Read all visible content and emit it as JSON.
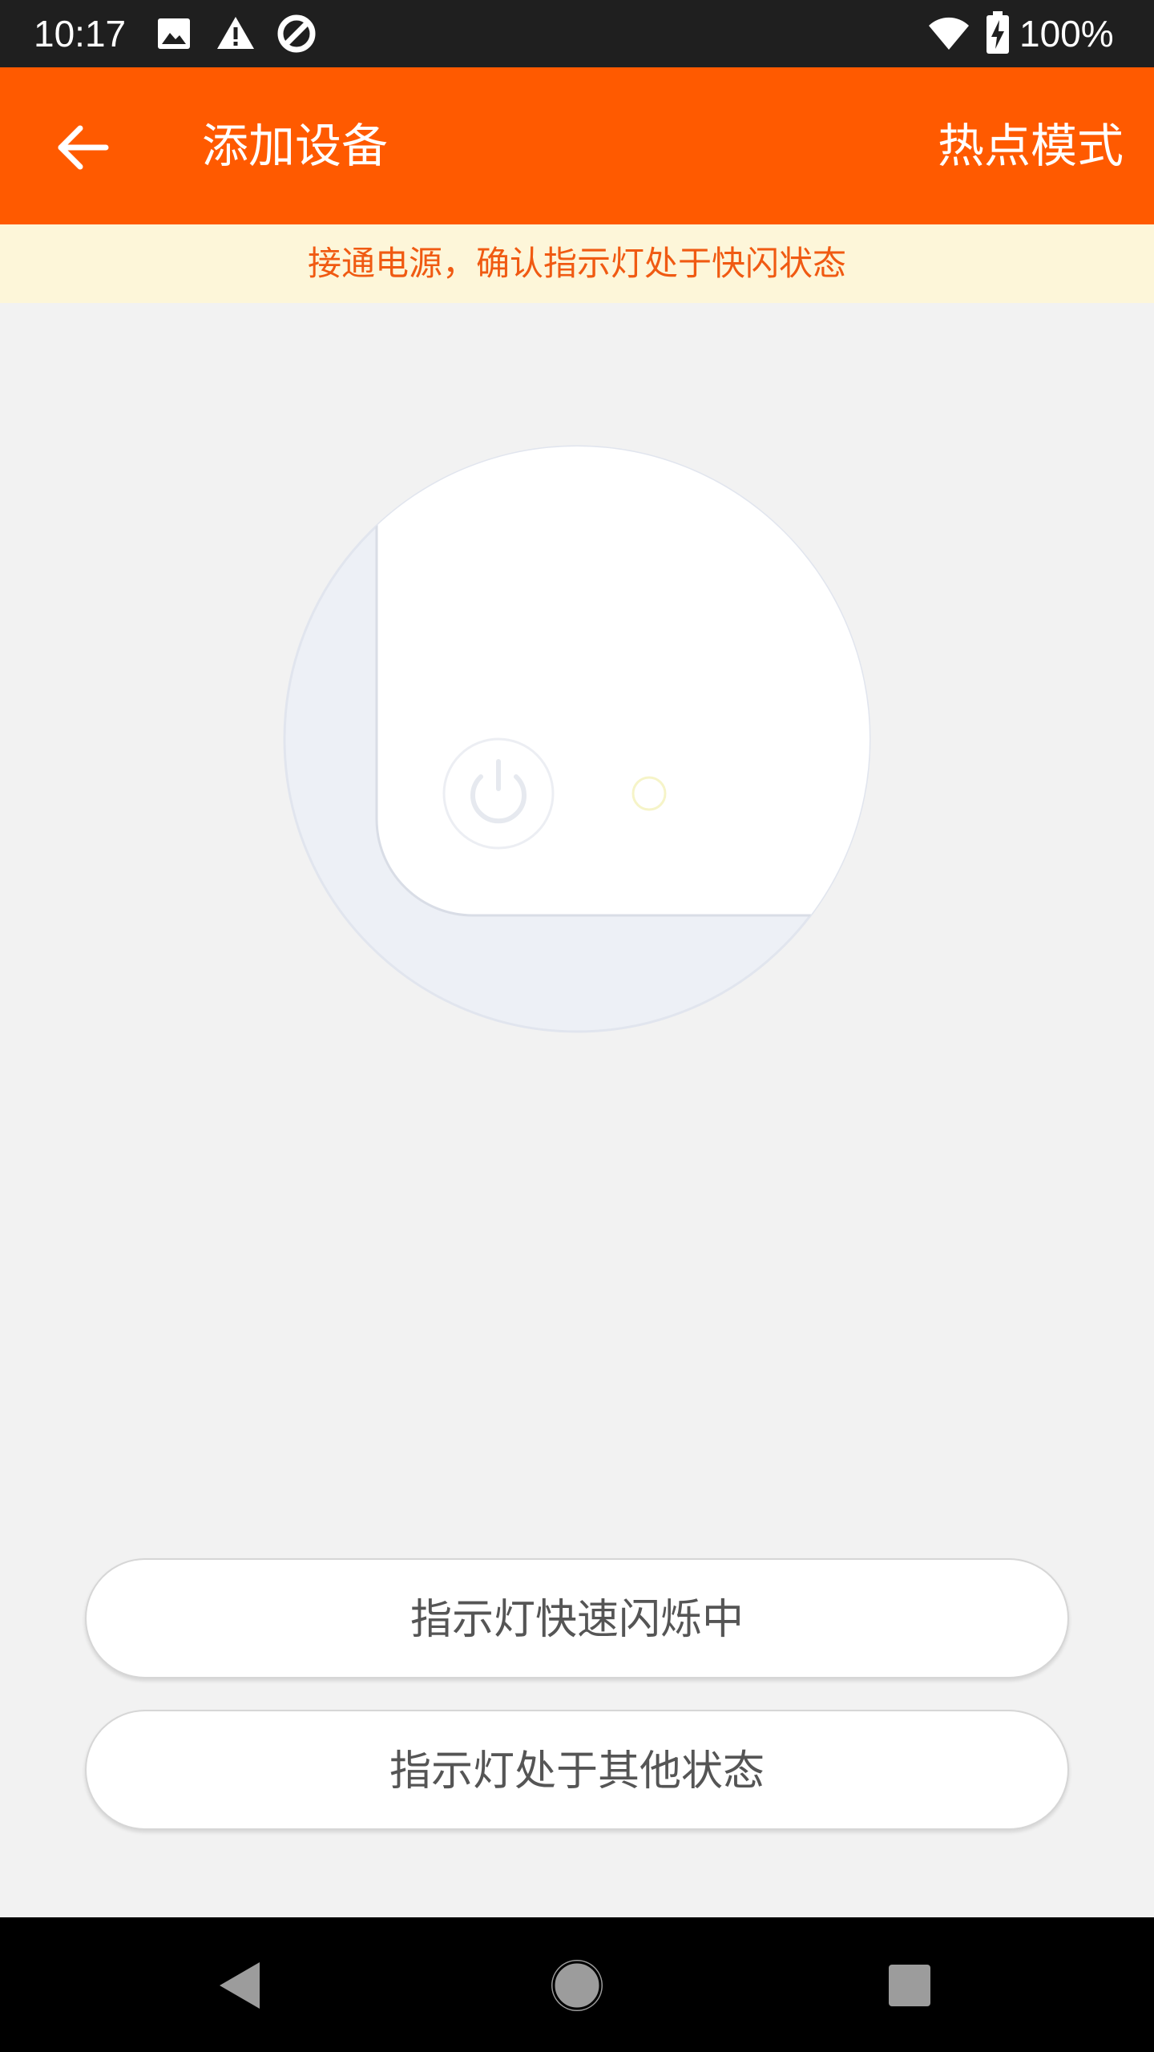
{
  "status_bar": {
    "time": "10:17",
    "battery_text": "100%",
    "icons": [
      "image-icon",
      "warning-icon",
      "data-saver-icon",
      "wifi-icon",
      "battery-charging-icon"
    ]
  },
  "app_bar": {
    "title": "添加设备",
    "right_action": "热点模式",
    "back_icon": "arrow-left-icon",
    "background_color": "#ff5a00"
  },
  "hint": {
    "text": "接通电源，确认指示灯处于快闪状态",
    "text_color": "#f05a12",
    "background_color": "#fdf6d9"
  },
  "illustration": {
    "icons": [
      "device-illustration",
      "power-button-icon",
      "indicator-light-icon"
    ]
  },
  "buttons": {
    "fast_blink": "指示灯快速闪烁中",
    "other_state": "指示灯处于其他状态"
  },
  "nav_bar": {
    "icons": [
      "back-triangle-icon",
      "home-circle-icon",
      "recents-square-icon"
    ]
  }
}
